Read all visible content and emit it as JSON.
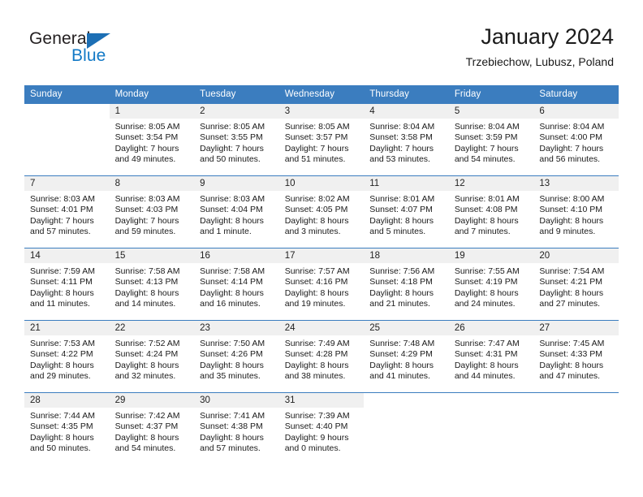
{
  "brand": {
    "name_part1": "General",
    "name_part2": "Blue",
    "color_dark": "#231f20",
    "color_blue": "#1279c6"
  },
  "header": {
    "title": "January 2024",
    "subtitle": "Trzebiechow, Lubusz, Poland"
  },
  "theme": {
    "header_row_bg": "#3b7dbf",
    "daynum_band_bg": "#f0f0f0",
    "grid_line": "#3b7dbf"
  },
  "weekday_headers": [
    "Sunday",
    "Monday",
    "Tuesday",
    "Wednesday",
    "Thursday",
    "Friday",
    "Saturday"
  ],
  "weeks": [
    [
      {
        "day": "",
        "sunrise": "",
        "sunset": "",
        "daylight_line1": "",
        "daylight_line2": ""
      },
      {
        "day": "1",
        "sunrise": "Sunrise: 8:05 AM",
        "sunset": "Sunset: 3:54 PM",
        "daylight_line1": "Daylight: 7 hours",
        "daylight_line2": "and 49 minutes."
      },
      {
        "day": "2",
        "sunrise": "Sunrise: 8:05 AM",
        "sunset": "Sunset: 3:55 PM",
        "daylight_line1": "Daylight: 7 hours",
        "daylight_line2": "and 50 minutes."
      },
      {
        "day": "3",
        "sunrise": "Sunrise: 8:05 AM",
        "sunset": "Sunset: 3:57 PM",
        "daylight_line1": "Daylight: 7 hours",
        "daylight_line2": "and 51 minutes."
      },
      {
        "day": "4",
        "sunrise": "Sunrise: 8:04 AM",
        "sunset": "Sunset: 3:58 PM",
        "daylight_line1": "Daylight: 7 hours",
        "daylight_line2": "and 53 minutes."
      },
      {
        "day": "5",
        "sunrise": "Sunrise: 8:04 AM",
        "sunset": "Sunset: 3:59 PM",
        "daylight_line1": "Daylight: 7 hours",
        "daylight_line2": "and 54 minutes."
      },
      {
        "day": "6",
        "sunrise": "Sunrise: 8:04 AM",
        "sunset": "Sunset: 4:00 PM",
        "daylight_line1": "Daylight: 7 hours",
        "daylight_line2": "and 56 minutes."
      }
    ],
    [
      {
        "day": "7",
        "sunrise": "Sunrise: 8:03 AM",
        "sunset": "Sunset: 4:01 PM",
        "daylight_line1": "Daylight: 7 hours",
        "daylight_line2": "and 57 minutes."
      },
      {
        "day": "8",
        "sunrise": "Sunrise: 8:03 AM",
        "sunset": "Sunset: 4:03 PM",
        "daylight_line1": "Daylight: 7 hours",
        "daylight_line2": "and 59 minutes."
      },
      {
        "day": "9",
        "sunrise": "Sunrise: 8:03 AM",
        "sunset": "Sunset: 4:04 PM",
        "daylight_line1": "Daylight: 8 hours",
        "daylight_line2": "and 1 minute."
      },
      {
        "day": "10",
        "sunrise": "Sunrise: 8:02 AM",
        "sunset": "Sunset: 4:05 PM",
        "daylight_line1": "Daylight: 8 hours",
        "daylight_line2": "and 3 minutes."
      },
      {
        "day": "11",
        "sunrise": "Sunrise: 8:01 AM",
        "sunset": "Sunset: 4:07 PM",
        "daylight_line1": "Daylight: 8 hours",
        "daylight_line2": "and 5 minutes."
      },
      {
        "day": "12",
        "sunrise": "Sunrise: 8:01 AM",
        "sunset": "Sunset: 4:08 PM",
        "daylight_line1": "Daylight: 8 hours",
        "daylight_line2": "and 7 minutes."
      },
      {
        "day": "13",
        "sunrise": "Sunrise: 8:00 AM",
        "sunset": "Sunset: 4:10 PM",
        "daylight_line1": "Daylight: 8 hours",
        "daylight_line2": "and 9 minutes."
      }
    ],
    [
      {
        "day": "14",
        "sunrise": "Sunrise: 7:59 AM",
        "sunset": "Sunset: 4:11 PM",
        "daylight_line1": "Daylight: 8 hours",
        "daylight_line2": "and 11 minutes."
      },
      {
        "day": "15",
        "sunrise": "Sunrise: 7:58 AM",
        "sunset": "Sunset: 4:13 PM",
        "daylight_line1": "Daylight: 8 hours",
        "daylight_line2": "and 14 minutes."
      },
      {
        "day": "16",
        "sunrise": "Sunrise: 7:58 AM",
        "sunset": "Sunset: 4:14 PM",
        "daylight_line1": "Daylight: 8 hours",
        "daylight_line2": "and 16 minutes."
      },
      {
        "day": "17",
        "sunrise": "Sunrise: 7:57 AM",
        "sunset": "Sunset: 4:16 PM",
        "daylight_line1": "Daylight: 8 hours",
        "daylight_line2": "and 19 minutes."
      },
      {
        "day": "18",
        "sunrise": "Sunrise: 7:56 AM",
        "sunset": "Sunset: 4:18 PM",
        "daylight_line1": "Daylight: 8 hours",
        "daylight_line2": "and 21 minutes."
      },
      {
        "day": "19",
        "sunrise": "Sunrise: 7:55 AM",
        "sunset": "Sunset: 4:19 PM",
        "daylight_line1": "Daylight: 8 hours",
        "daylight_line2": "and 24 minutes."
      },
      {
        "day": "20",
        "sunrise": "Sunrise: 7:54 AM",
        "sunset": "Sunset: 4:21 PM",
        "daylight_line1": "Daylight: 8 hours",
        "daylight_line2": "and 27 minutes."
      }
    ],
    [
      {
        "day": "21",
        "sunrise": "Sunrise: 7:53 AM",
        "sunset": "Sunset: 4:22 PM",
        "daylight_line1": "Daylight: 8 hours",
        "daylight_line2": "and 29 minutes."
      },
      {
        "day": "22",
        "sunrise": "Sunrise: 7:52 AM",
        "sunset": "Sunset: 4:24 PM",
        "daylight_line1": "Daylight: 8 hours",
        "daylight_line2": "and 32 minutes."
      },
      {
        "day": "23",
        "sunrise": "Sunrise: 7:50 AM",
        "sunset": "Sunset: 4:26 PM",
        "daylight_line1": "Daylight: 8 hours",
        "daylight_line2": "and 35 minutes."
      },
      {
        "day": "24",
        "sunrise": "Sunrise: 7:49 AM",
        "sunset": "Sunset: 4:28 PM",
        "daylight_line1": "Daylight: 8 hours",
        "daylight_line2": "and 38 minutes."
      },
      {
        "day": "25",
        "sunrise": "Sunrise: 7:48 AM",
        "sunset": "Sunset: 4:29 PM",
        "daylight_line1": "Daylight: 8 hours",
        "daylight_line2": "and 41 minutes."
      },
      {
        "day": "26",
        "sunrise": "Sunrise: 7:47 AM",
        "sunset": "Sunset: 4:31 PM",
        "daylight_line1": "Daylight: 8 hours",
        "daylight_line2": "and 44 minutes."
      },
      {
        "day": "27",
        "sunrise": "Sunrise: 7:45 AM",
        "sunset": "Sunset: 4:33 PM",
        "daylight_line1": "Daylight: 8 hours",
        "daylight_line2": "and 47 minutes."
      }
    ],
    [
      {
        "day": "28",
        "sunrise": "Sunrise: 7:44 AM",
        "sunset": "Sunset: 4:35 PM",
        "daylight_line1": "Daylight: 8 hours",
        "daylight_line2": "and 50 minutes."
      },
      {
        "day": "29",
        "sunrise": "Sunrise: 7:42 AM",
        "sunset": "Sunset: 4:37 PM",
        "daylight_line1": "Daylight: 8 hours",
        "daylight_line2": "and 54 minutes."
      },
      {
        "day": "30",
        "sunrise": "Sunrise: 7:41 AM",
        "sunset": "Sunset: 4:38 PM",
        "daylight_line1": "Daylight: 8 hours",
        "daylight_line2": "and 57 minutes."
      },
      {
        "day": "31",
        "sunrise": "Sunrise: 7:39 AM",
        "sunset": "Sunset: 4:40 PM",
        "daylight_line1": "Daylight: 9 hours",
        "daylight_line2": "and 0 minutes."
      },
      {
        "day": "",
        "sunrise": "",
        "sunset": "",
        "daylight_line1": "",
        "daylight_line2": ""
      },
      {
        "day": "",
        "sunrise": "",
        "sunset": "",
        "daylight_line1": "",
        "daylight_line2": ""
      },
      {
        "day": "",
        "sunrise": "",
        "sunset": "",
        "daylight_line1": "",
        "daylight_line2": ""
      }
    ]
  ]
}
